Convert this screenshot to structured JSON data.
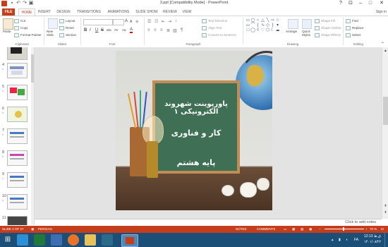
{
  "window": {
    "title": "3.ppt [Compatibility Mode] - PowerPoint",
    "help": "?",
    "sign_in": "Sign in"
  },
  "tabs": [
    "FILE",
    "HOME",
    "INSERT",
    "DESIGN",
    "TRANSITIONS",
    "ANIMATIONS",
    "SLIDE SHOW",
    "REVIEW",
    "VIEW"
  ],
  "ribbon": {
    "clipboard": {
      "label": "Clipboard",
      "paste": "Paste",
      "cut": "Cut",
      "copy": "Copy",
      "format_painter": "Format Painter"
    },
    "slides": {
      "label": "Slides",
      "new_slide": "New Slide",
      "layout": "Layout",
      "reset": "Reset",
      "section": "Section"
    },
    "font": {
      "label": "Font",
      "bold": "B",
      "italic": "I",
      "underline": "U",
      "strike": "S",
      "shadow": "abc",
      "spacing": "AV",
      "case": "Aa",
      "color": "A"
    },
    "paragraph": {
      "label": "Paragraph",
      "text_direction": "Text Direction",
      "align_text": "Align Text",
      "convert_smartart": "Convert to SmartArt"
    },
    "drawing": {
      "label": "Drawing",
      "arrange": "Arrange",
      "quick_styles": "Quick Styles",
      "shape_fill": "Shape Fill",
      "shape_outline": "Shape Outline",
      "shape_effects": "Shape Effects"
    },
    "editing": {
      "label": "Editing",
      "find": "Find",
      "replace": "Replace",
      "select": "Select"
    }
  },
  "thumbnails": [
    {
      "num": "",
      "star": ""
    },
    {
      "num": "4",
      "star": "*"
    },
    {
      "num": "5",
      "star": "*"
    },
    {
      "num": "6",
      "star": "*"
    },
    {
      "num": "7",
      "star": "*"
    },
    {
      "num": "8",
      "star": "*"
    },
    {
      "num": "9",
      "star": "*"
    },
    {
      "num": "10",
      "star": "*"
    },
    {
      "num": "11",
      "star": ""
    }
  ],
  "slide": {
    "line1": "پاورپوینت شهروند الکترونیکی ۱",
    "line2": "کار و فناوری",
    "line3": "پایه هشتم"
  },
  "notes": {
    "placeholder": "Click to add notes"
  },
  "statusbar": {
    "slide_info": "SLIDE 2 OF 27",
    "language": "PERSIAN",
    "notes": "NOTES",
    "comments": "COMMENTS",
    "zoom": "70 %"
  },
  "taskbar": {
    "lang": "FA",
    "time": "12:13 ق.ظ",
    "date": "۱۴۰۱/۰۸/۲۲"
  },
  "colors": {
    "accent": "#c43e1c",
    "taskbar": "#1b4f77",
    "board": "#3f6f55",
    "frame": "#c08e55"
  }
}
